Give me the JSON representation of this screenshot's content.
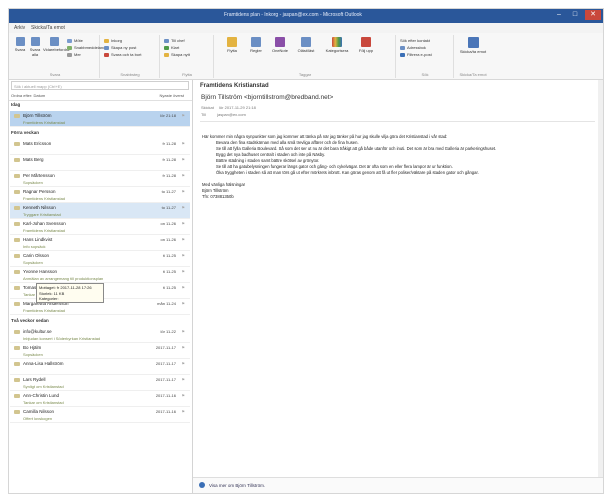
{
  "window": {
    "title": "Framtidens plan - Inkorg - jaspan@ex.com - Microsoft Outlook",
    "minimize": "–",
    "maximize": "□",
    "close": "✕"
  },
  "tabs": [
    "Arkiv",
    "Skicka/Ta emot"
  ],
  "ribbon": {
    "groups": [
      {
        "label": "Svara",
        "buttons": [
          "Svara",
          "Svara alla",
          "Vidarebefordra"
        ],
        "small": [
          "Möte",
          "Snabbmeddelande",
          "Mer"
        ]
      },
      {
        "label": "Snabbsteg",
        "small": [
          "Inkorg",
          "Skapa ny post",
          "Svara och ta bort"
        ]
      },
      {
        "label": "Flytta",
        "small": [
          "Till chef",
          "Klart",
          "Skapa nytt"
        ]
      },
      {
        "label": "Taggar",
        "buttons": [
          "Flytta",
          "Regler",
          "OneNote",
          "Oläst/läst",
          "Kategorisera",
          "Följ upp"
        ]
      },
      {
        "label": "Sök",
        "small": [
          "Sök efter kontakt",
          "Adressbok",
          "Filtrera e-post"
        ]
      },
      {
        "label": "Skicka/Ta emot",
        "buttons": [
          "Skicka/ta emot"
        ]
      }
    ]
  },
  "search": {
    "placeholder": "Sök i aktuell mapp (Ctrl+E)"
  },
  "sort": {
    "left": "Ordna efter: Datum",
    "right": "Nyaste överst"
  },
  "groups": [
    {
      "label": "Idag",
      "items": [
        {
          "name": "Björn Tillström",
          "sub": "Framtidens Kristianstad",
          "date": "lör 21:18",
          "selected": true
        }
      ]
    },
    {
      "label": "Förra veckan",
      "items": [
        {
          "name": "Mats Ericsson",
          "sub": "",
          "date": "fr 11-28"
        },
        {
          "name": "Mats Berg",
          "sub": "",
          "date": "fr 11-28"
        },
        {
          "name": "Per Mårtensson",
          "sub": "Sopsäcken",
          "date": "fr 11-28"
        },
        {
          "name": "Ragnar Persson",
          "sub": "Framtidens Kristianstad",
          "date": "to 11-27"
        },
        {
          "name": "Kenneth Nilsson",
          "sub": "Tryggare Kristianstad",
          "date": "to 11-27"
        },
        {
          "name": "Karl-Johan Svensson",
          "sub": "Framtidens Kristianstad",
          "date": "on 11-26"
        },
        {
          "name": "Hans Lindkvist",
          "sub": "Info sopsäck",
          "date": "on 11-26"
        },
        {
          "name": "Carin Olsson",
          "sub": "Sopsäcken",
          "date": "ti 11-25"
        },
        {
          "name": "Yvonne Hansson",
          "sub": "Anmälan av arrangemang till produktionsplan",
          "date": "ti 11-25"
        },
        {
          "name": "Tomas Persson",
          "sub": "Tankar om Kristianstad",
          "date": "ti 11-25"
        },
        {
          "name": "Margaretha Andersson",
          "sub": "Framtidens Kristianstad",
          "date": "mån 11-24"
        }
      ]
    },
    {
      "label": "Två veckor sedan",
      "items": [
        {
          "name": "info@kultur.se",
          "sub": "Inbjudan konsert i Söderkyrkan Kristianstad",
          "date": "lör 11-22"
        },
        {
          "name": "Bo Hjälm",
          "sub": "Sopsäcken",
          "date": "2017-11-17"
        },
        {
          "name": "Anna-Lisa Hallström",
          "sub": "",
          "date": "2017-11-17"
        },
        {
          "name": "Lars Rydell",
          "sub": "Synligt om Kristianstad",
          "date": "2017-11-17"
        },
        {
          "name": "Ann-Christin Lund",
          "sub": "Tankar om Kristianstad",
          "date": "2017-11-16"
        },
        {
          "name": "Camilla Nilsson",
          "sub": "Offert lovskogen",
          "date": "2017-11-16"
        }
      ]
    }
  ],
  "tooltip": {
    "line1": "Mottaget: fr 2017-11-28 17:26",
    "line2": "Storlek: 11 KB",
    "line3": "Kategorier:"
  },
  "message": {
    "subject": "Framtidens Kristianstad",
    "sender": "Björn Tillström <bjorntillstrom@bredband.net>",
    "sent_label": "Skickat",
    "sent_value": "lör 2017-11-29 21:18",
    "to_label": "Till",
    "to_value": "jaspan@ex.com",
    "intro": "Här kommer min några synpunkter som jag kommer att tänka på när jag tänker på hur jag skulle vilja göra det Kristianstad i vår stad:",
    "points": [
      "Bevara den fina stadskärnan med alla små trevliga affärer och de fina husen.",
      "Se till att fylla Galleria Boulevard. Så som det ser ut nu är det bara tråkigt att gå både utanför och inuti. Det som är bra med Galleria är parkeringshuset.",
      "Bygg det nya badhuset centralt i staden och inte på Näsby.",
      "Bättre städning i staden samt bättre skötsel av grönytor.",
      "Se till att ha gatubelysningen fungerar längs gator och gång- och cykelvägar. Det är ofta som en eller flera lampor är ur funktion.",
      "Öka tryggheten i staden så att man törs gå ut efter mörkrets inbrott. Kan göras genom att få ut fler poliser/väktare på staden gator och gångar."
    ],
    "closing": "Med vänliga hälsningar",
    "name": "Björn Tillström",
    "phone": "Tfn: 073881350b"
  },
  "people_bar": "Visa mer om Björn Tillström.",
  "colors": {
    "titlebar": "#2a579a",
    "selected": "#b9d3ee",
    "subject_green": "#7a8a4c"
  }
}
